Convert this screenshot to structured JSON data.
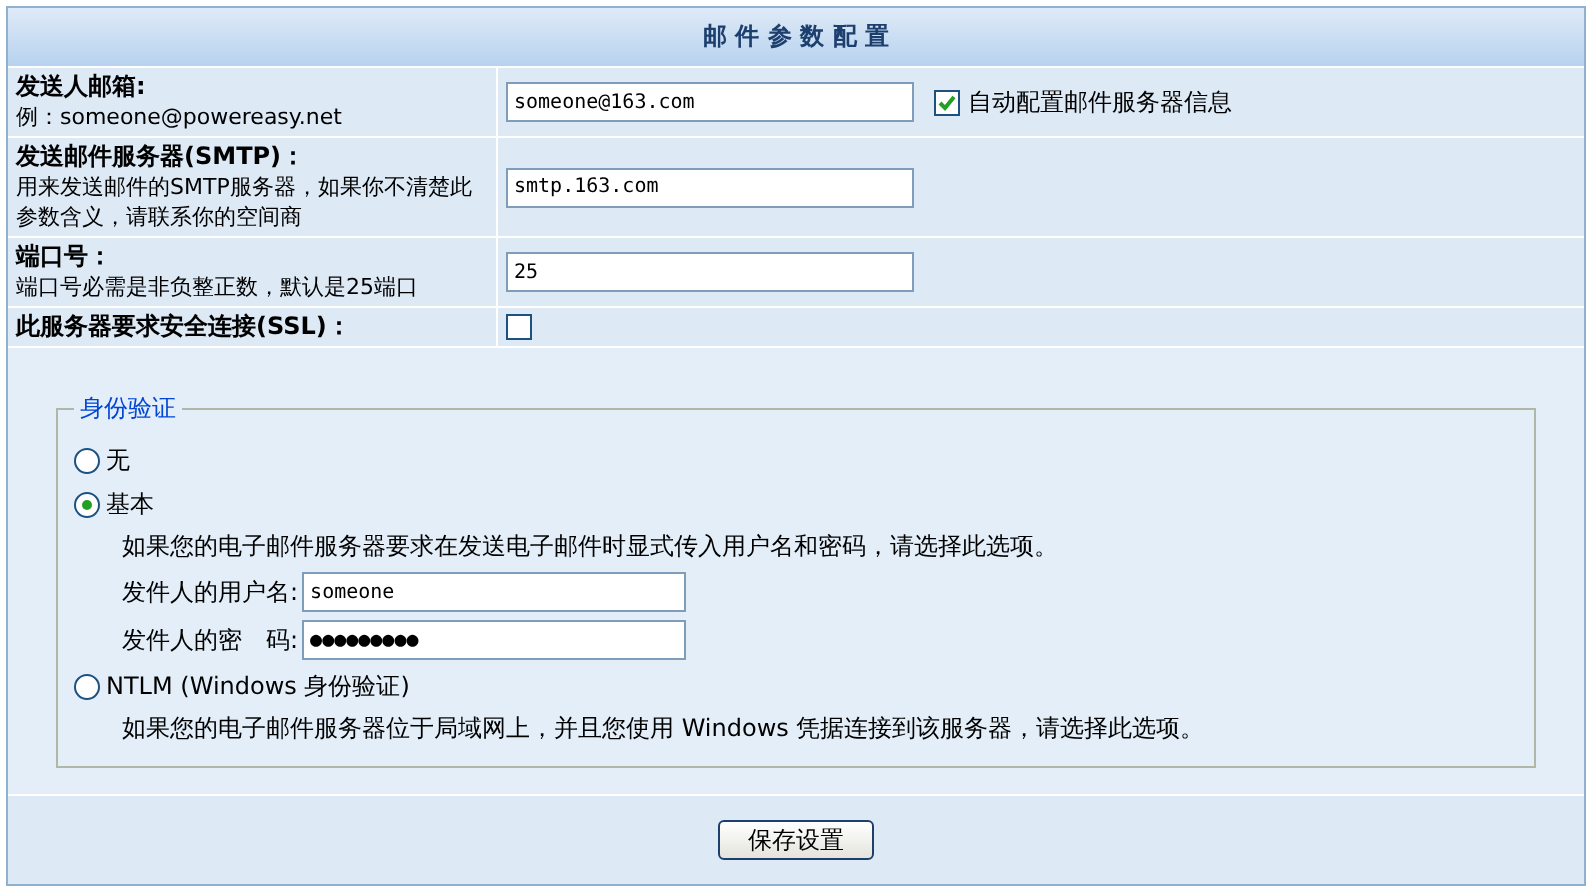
{
  "title": "邮 件 参 数 配 置",
  "rows": [
    {
      "kind": "text",
      "label": "发送人邮箱:",
      "description": "例：someone@powereasy.net",
      "value": "someone@163.com",
      "checkbox": {
        "label": "自动配置邮件服务器信息",
        "checked": true
      }
    },
    {
      "kind": "text",
      "label": "发送邮件服务器(SMTP)：",
      "description": "用来发送邮件的SMTP服务器，如果你不清楚此参数含义，请联系你的空间商",
      "value": "smtp.163.com"
    },
    {
      "kind": "text",
      "label": "端口号：",
      "description": "端口号必需是非负整正数，默认是25端口",
      "value": "25"
    },
    {
      "kind": "checkbox",
      "label": "此服务器要求安全连接(SSL)：",
      "checked": false
    }
  ],
  "auth": {
    "legend": "身份验证",
    "options": [
      {
        "label": "无",
        "selected": false
      },
      {
        "label": "基本",
        "selected": true,
        "description": "如果您的电子邮件服务器要求在发送电子邮件时显式传入用户名和密码，请选择此选项。",
        "fields": [
          {
            "label": "发件人的用户名:",
            "value": "someone"
          },
          {
            "label": "发件人的密　码:",
            "value": "●●●●●●●●●"
          }
        ]
      },
      {
        "label": "NTLM (Windows 身份验证)",
        "selected": false,
        "description": "如果您的电子邮件服务器位于局域网上，并且您使用 Windows 凭据连接到该服务器，请选择此选项。"
      }
    ]
  },
  "save_button": "保存设置"
}
